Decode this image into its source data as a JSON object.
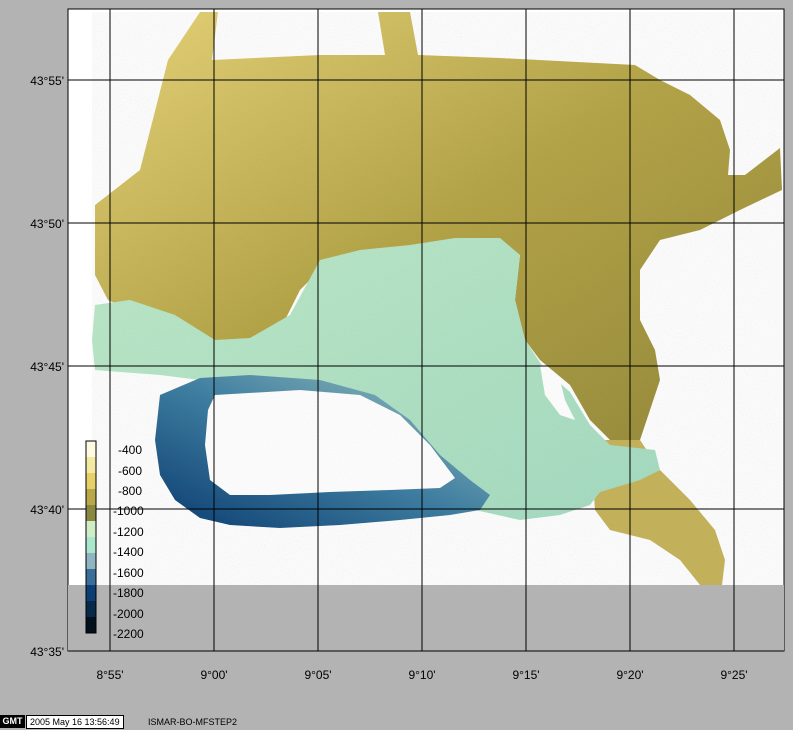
{
  "map": {
    "lon_ticks": [
      "8°55'",
      "9°00'",
      "9°05'",
      "9°10'",
      "9°15'",
      "9°20'",
      "9°25'"
    ],
    "lat_ticks": [
      "43°55'",
      "43°50'",
      "43°45'",
      "43°40'",
      "43°35'"
    ],
    "no_data_color": "#b3b3b3",
    "frame_color": "#ffffff"
  },
  "colorbar": {
    "labels": [
      "-400",
      "-600",
      "-800",
      "-1000",
      "-1200",
      "-1400",
      "-1600",
      "-1800",
      "-2000",
      "-2200"
    ],
    "colors": [
      "#fffbe0",
      "#f3e9a0",
      "#e6d06a",
      "#b9a84a",
      "#8a8740",
      "#cfeec8",
      "#a9e6cc",
      "#8fb6c0",
      "#3a6f9a",
      "#0b3e72",
      "#06284a",
      "#02101c"
    ]
  },
  "footer": {
    "logo": "GMT",
    "timestamp": "2005 May 16 13:56:49",
    "run_label": "ISMAR-BO-MFSTEP2"
  }
}
